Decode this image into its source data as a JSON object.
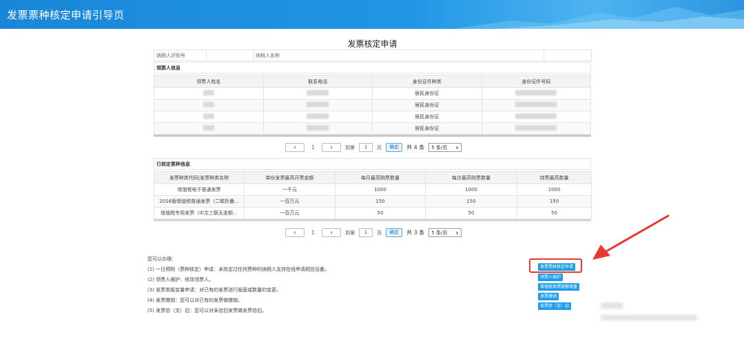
{
  "header": {
    "title": "发票票种核定申请引导页"
  },
  "panel": {
    "title": "发票核定申请",
    "taxpayer_id_label": "纳税人识别号",
    "taxpayer_name_label": "纳税人名称",
    "section_receivers": "领票人信息",
    "section_approved": "已核定票种信息"
  },
  "receivers": {
    "columns": [
      "领票人姓名",
      "联系电话",
      "身份证件种类",
      "身份证件号码"
    ],
    "rows": [
      {
        "id_type": "居民身份证"
      },
      {
        "id_type": "居民身份证"
      },
      {
        "id_type": "居民身份证"
      },
      {
        "id_type": "居民身份证"
      }
    ]
  },
  "pager1": {
    "page": "1",
    "goto_label": "到第",
    "input": "1",
    "page_unit": "页",
    "go": "确定",
    "total": "共 4 条",
    "size": "5 条/页"
  },
  "approved": {
    "columns": [
      "发票种类代码|发票种类名称",
      "单份发票最高开票金额",
      "每月最高购票数量",
      "每次最高购票数量",
      "持票最高数量"
    ],
    "rows": [
      {
        "name": "增值税电子普通发票",
        "max_amount": "一千元",
        "monthly": "1000",
        "per_time": "1000",
        "holding": "1000"
      },
      {
        "name": "2016版增值税普通发票（二联折叠...",
        "max_amount": "一百万元",
        "monthly": "150",
        "per_time": "150",
        "holding": "150"
      },
      {
        "name": "增值税专用发票（中文三联无金额...",
        "max_amount": "一百万元",
        "monthly": "50",
        "per_time": "50",
        "holding": "50"
      }
    ]
  },
  "pager2": {
    "page": "1",
    "goto_label": "到第",
    "input": "1",
    "page_unit": "页",
    "go": "确定",
    "total": "共 3 条",
    "size": "5 条/页"
  },
  "notes": {
    "heading": "您可以办理：",
    "lines": [
      "(1) 一日预购（票种核定）申请：未核定过任何票种的纳税人支持在线申请税控设备。",
      "(2) 领票人维护：修改领票人。",
      "(3) 发票类版变量申请：对已有的发票进行版面或数量的变更。",
      "(4) 发票缴销：您可以对已有的发票做缴销。",
      "(5) 发票验（交）旧：您可以对未验旧发票做发票验旧。"
    ]
  },
  "actions": [
    {
      "label": "发票票种核定申请"
    },
    {
      "label": "领票人维护"
    },
    {
      "label": "增值税发票版额增量"
    },
    {
      "label": "发票缴销"
    },
    {
      "label": "发票验（交）旧"
    }
  ],
  "colors": {
    "header": "#1a86d8",
    "button": "#1f9ee8",
    "highlight": "#e8372c"
  },
  "icons": {
    "prev": "chevron-left-icon",
    "next": "chevron-right-icon",
    "dropdown": "chevron-down-icon"
  }
}
